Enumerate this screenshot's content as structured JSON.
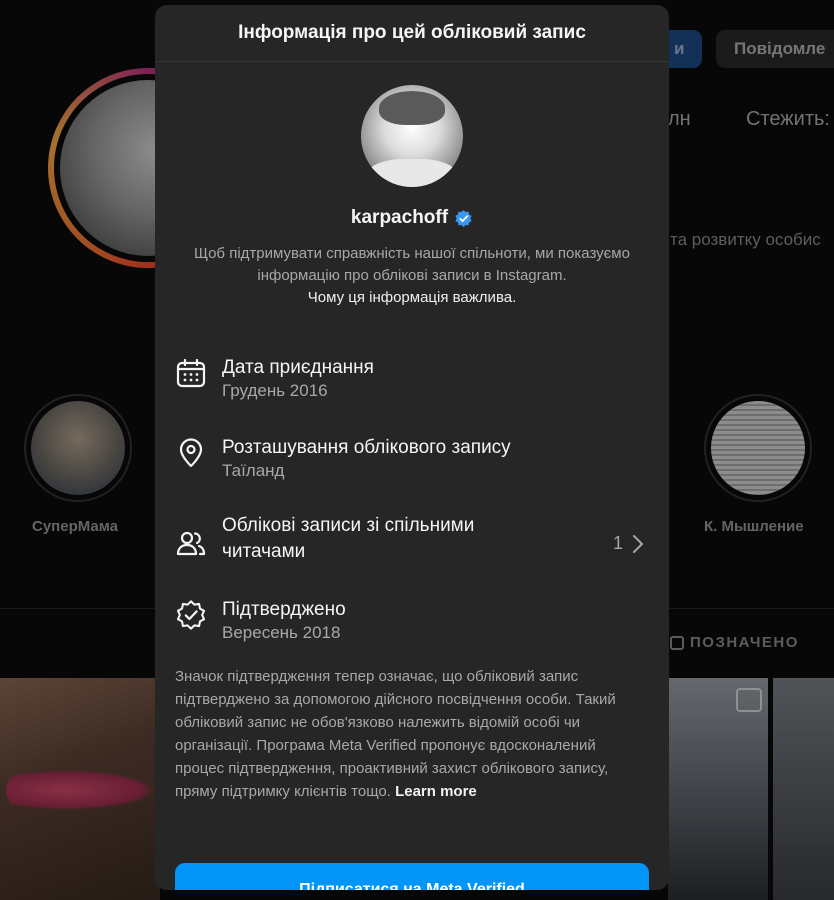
{
  "background": {
    "follow_label": "и",
    "message_label": "Повідомле",
    "stat_posts": "лн",
    "stat_following": "Стежить:",
    "bio_fragment": "та розвитку особис",
    "highlights": [
      {
        "label": "СуперМама"
      },
      {
        "label": "К. Мышление"
      }
    ],
    "tagged_label": "ПОЗНАЧЕНО"
  },
  "modal": {
    "title": "Інформація про цей обліковий запис",
    "username": "karpachoff",
    "explanation": "Щоб підтримувати справжність нашої спільноти, ми показуємо інформацію про облікові записи в Instagram.",
    "explanation_link": "Чому ця інформація важлива.",
    "rows": [
      {
        "icon": "calendar-icon",
        "title": "Дата приєднання",
        "subtitle": "Грудень 2016"
      },
      {
        "icon": "location-pin-icon",
        "title": "Розташування облікового запису",
        "subtitle": "Таїланд"
      },
      {
        "icon": "people-icon",
        "title": "Облікові записи зі спільними читачами",
        "count": "1"
      },
      {
        "icon": "verified-seal-icon",
        "title": "Підтверджено",
        "subtitle": "Вересень 2018"
      }
    ],
    "verification_note": "Значок підтвердження тепер означає, що обліковий запис підтверджено за допомогою дійсного посвідчення особи. Такий обліковий запис не обов'язково належить відомій особі чи організації. Програма Meta Verified пропонує вдосконалений процес підтвердження, проактивний захист облікового запису, пряму підтримку клієнтів тощо.",
    "learn_more": "Learn more",
    "cta_label": "Підписатися на Meta Verified"
  },
  "colors": {
    "accent": "#0095f6",
    "modal_bg": "#262626",
    "verified_badge": "#3897f0"
  }
}
